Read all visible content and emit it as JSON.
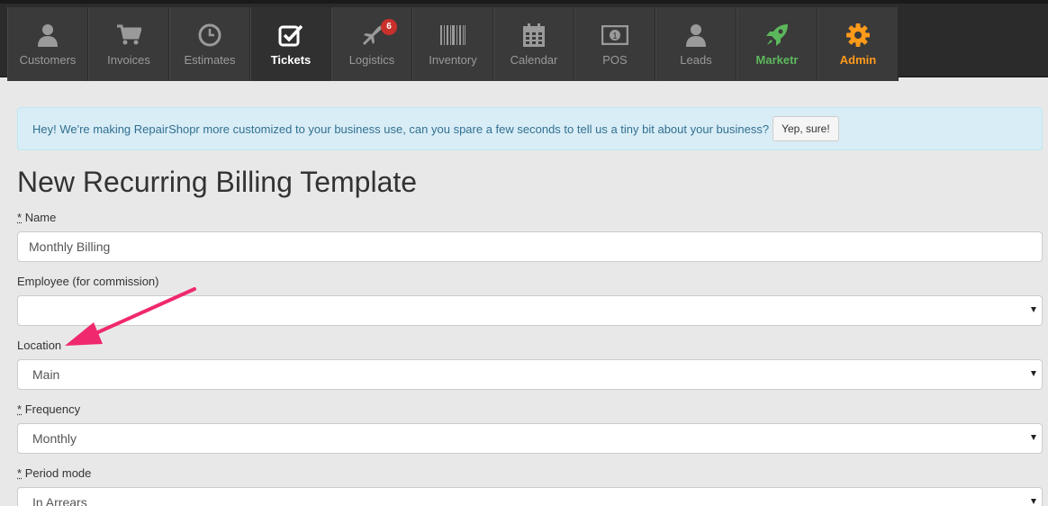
{
  "nav": {
    "items": [
      {
        "label": "Customers",
        "icon": "user-icon"
      },
      {
        "label": "Invoices",
        "icon": "cart-icon"
      },
      {
        "label": "Estimates",
        "icon": "clock-icon"
      },
      {
        "label": "Tickets",
        "icon": "checkbox-icon"
      },
      {
        "label": "Logistics",
        "icon": "plane-icon",
        "badge": "6"
      },
      {
        "label": "Inventory",
        "icon": "barcode-icon"
      },
      {
        "label": "Calendar",
        "icon": "calendar-icon"
      },
      {
        "label": "POS",
        "icon": "money-icon"
      },
      {
        "label": "Leads",
        "icon": "user-icon"
      },
      {
        "label": "Marketr",
        "icon": "rocket-icon"
      },
      {
        "label": "Admin",
        "icon": "gear-icon"
      }
    ],
    "active": "Tickets",
    "colors": {
      "marketr": "#5cb85c",
      "admin": "#ff9a1a",
      "badge": "#c9302c"
    }
  },
  "alert": {
    "text": "Hey! We're making RepairShopr more customized to your business use, can you spare a few seconds to tell us a tiny bit about your business?",
    "button": "Yep, sure!"
  },
  "page": {
    "title": "New Recurring Billing Template"
  },
  "form": {
    "name": {
      "required_mark": "*",
      "label": "Name",
      "value": "Monthly Billing"
    },
    "employee": {
      "label": "Employee (for commission)",
      "value": ""
    },
    "location": {
      "label": "Location",
      "value": "Main"
    },
    "frequency": {
      "required_mark": "*",
      "label": "Frequency",
      "value": "Monthly"
    },
    "period_mode": {
      "required_mark": "*",
      "label": "Period mode",
      "value": "In Arrears"
    }
  },
  "annotation": {
    "arrow_color": "#f0286e"
  }
}
